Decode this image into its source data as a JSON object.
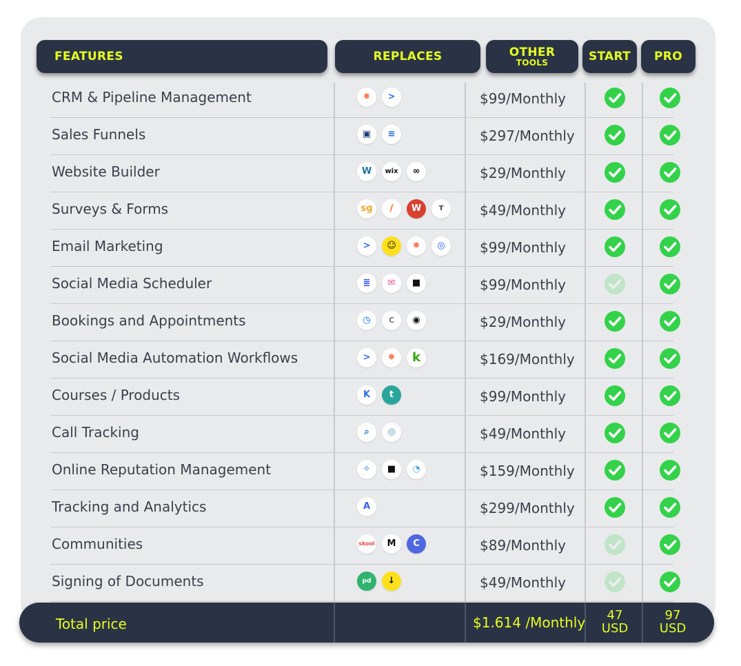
{
  "headers": {
    "features": "FEATURES",
    "replaces": "REPLACES",
    "other": "OTHER",
    "other_sub": "TOOLS",
    "start": "START",
    "pro": "PRO"
  },
  "colors": {
    "accent": "#e5ff1f",
    "dark": "#2a3346",
    "check": "#33d24a",
    "card": "#e9eaec"
  },
  "rows": [
    {
      "feature": "CRM & Pipeline Management",
      "icons": [
        "hubspot-icon",
        "activecampaign-icon"
      ],
      "price": "$99/Monthly",
      "start": true,
      "pro": true
    },
    {
      "feature": "Sales Funnels",
      "icons": [
        "clickfunnels-icon",
        "leadpages-icon"
      ],
      "price": "$297/Monthly",
      "start": true,
      "pro": true
    },
    {
      "feature": "Website Builder",
      "icons": [
        "wordpress-icon",
        "wix-icon",
        "squarespace-icon"
      ],
      "price": "$29/Monthly",
      "start": true,
      "pro": true
    },
    {
      "feature": "Surveys & Forms",
      "icons": [
        "surveygizmo-icon",
        "jotform-icon",
        "wufoo-icon",
        "typeform-icon"
      ],
      "price": "$49/Monthly",
      "start": true,
      "pro": true
    },
    {
      "feature": "Email Marketing",
      "icons": [
        "activecampaign-icon",
        "mailchimp-icon",
        "hubspot-icon",
        "constantcontact-icon"
      ],
      "price": "$99/Monthly",
      "start": true,
      "pro": true
    },
    {
      "feature": "Social Media Scheduler",
      "icons": [
        "buffer-icon",
        "later-icon",
        "hootsuite-icon"
      ],
      "price": "$99/Monthly",
      "start": false,
      "pro": true
    },
    {
      "feature": "Bookings and Appointments",
      "icons": [
        "calendly-icon",
        "calendar-icon",
        "acuity-icon"
      ],
      "price": "$29/Monthly",
      "start": true,
      "pro": true
    },
    {
      "feature": "Social Media Automation Workflows",
      "icons": [
        "activecampaign-icon",
        "hubspot-icon",
        "keap-icon"
      ],
      "price": "$169/Monthly",
      "start": true,
      "pro": true
    },
    {
      "feature": "Courses / Products",
      "icons": [
        "kajabi-icon",
        "teachable-icon"
      ],
      "price": "$99/Monthly",
      "start": true,
      "pro": true
    },
    {
      "feature": "Call Tracking",
      "icons": [
        "callrail-icon",
        "calltrackingmetrics-icon"
      ],
      "price": "$49/Monthly",
      "start": true,
      "pro": true
    },
    {
      "feature": "Online Reputation Management",
      "icons": [
        "birdeye-icon",
        "podium-icon",
        "reputation-icon"
      ],
      "price": "$159/Monthly",
      "start": true,
      "pro": true
    },
    {
      "feature": "Tracking and Analytics",
      "icons": [
        "analytics-icon"
      ],
      "price": "$299/Monthly",
      "start": true,
      "pro": true
    },
    {
      "feature": "Communities",
      "icons": [
        "skool-icon",
        "mightynetworks-icon",
        "circle-icon"
      ],
      "price": "$89/Monthly",
      "start": false,
      "pro": true
    },
    {
      "feature": "Signing of Documents",
      "icons": [
        "pandadoc-icon",
        "docusign-icon"
      ],
      "price": "$49/Monthly",
      "start": false,
      "pro": true
    }
  ],
  "footer": {
    "label": "Total price",
    "other_price": "$1.614 /Monthly",
    "start_amount": "47",
    "start_currency": "USD",
    "pro_amount": "97",
    "pro_currency": "USD"
  }
}
